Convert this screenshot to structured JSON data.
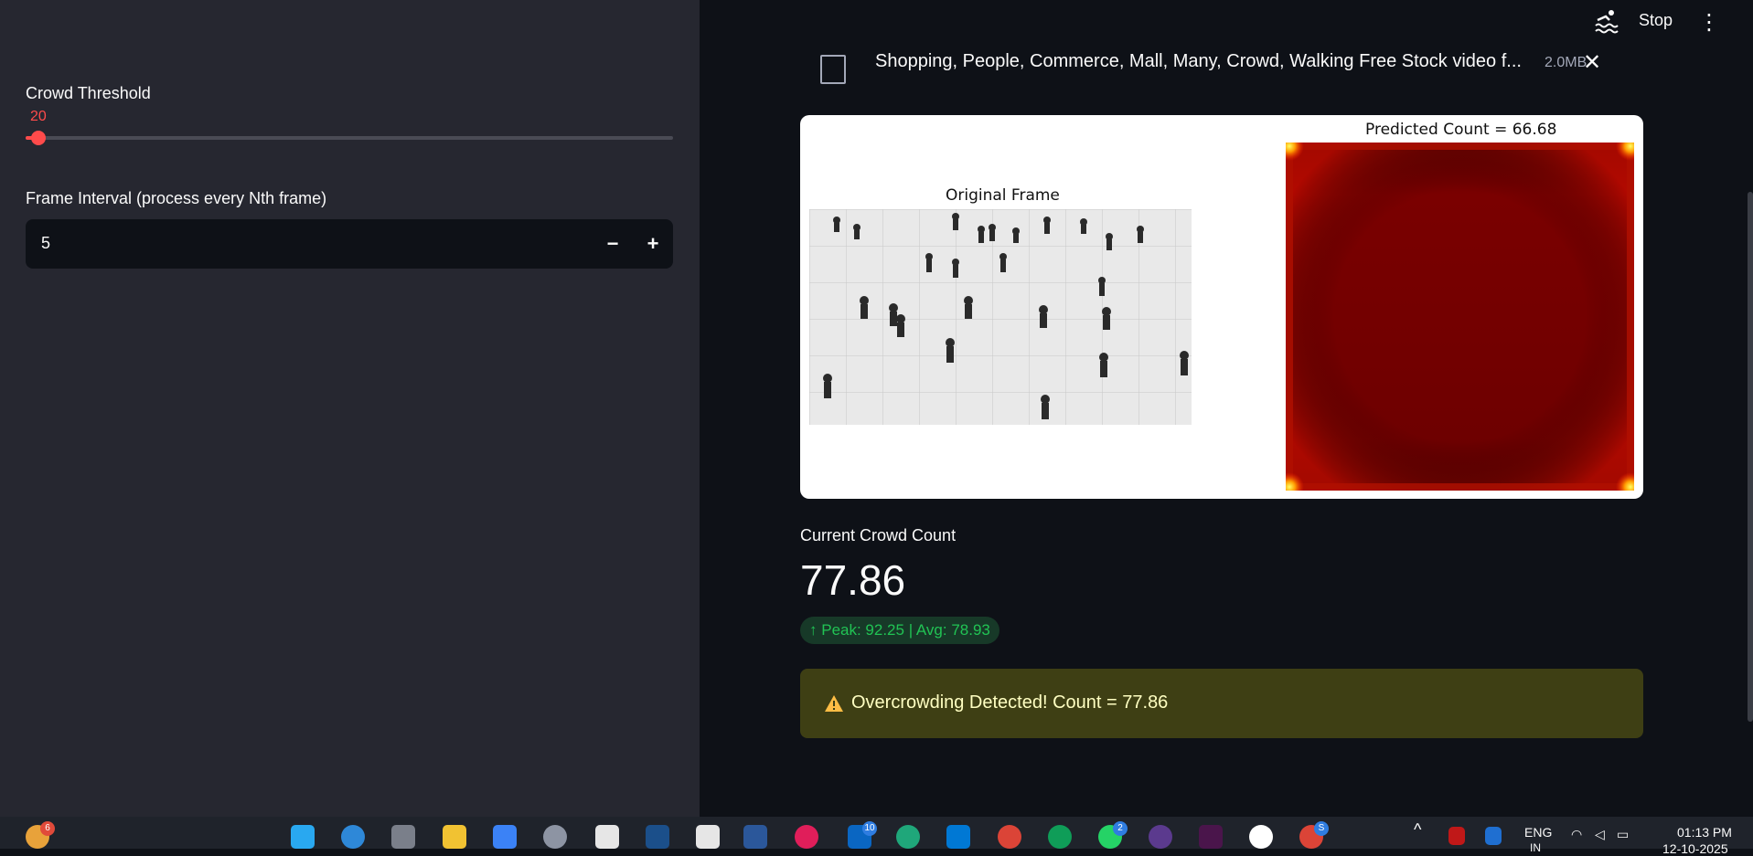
{
  "sidebar": {
    "threshold_label": "Crowd Threshold",
    "threshold_value": "20",
    "threshold_fraction": 0.02,
    "interval_label": "Frame Interval (process every Nth frame)",
    "interval_value": "5",
    "minus_label": "−",
    "plus_label": "+"
  },
  "header": {
    "stop_label": "Stop",
    "menu_label": "⋮"
  },
  "file": {
    "name": "Shopping, People, Commerce, Mall, Many, Crowd, Walking Free Stock video f...",
    "size": "2.0MB",
    "close_label": "✕"
  },
  "figure": {
    "left_title": "Original Frame",
    "right_title": "Predicted Count = 66.68"
  },
  "metric": {
    "label": "Current Crowd Count",
    "value": "77.86",
    "delta": "Peak: 92.25 | Avg: 78.93",
    "delta_arrow": "↑"
  },
  "alert": {
    "text": "Overcrowding Detected! Count = 77.86"
  },
  "taskbar": {
    "badge_1": "6",
    "badge_linkedin": "10",
    "badge_whatsapp": "2",
    "badge_chrome": "S",
    "lang": "ENG",
    "lang_sub": "IN",
    "time": "01:13 PM",
    "date": "12-10-2025"
  },
  "colors": {
    "accent": "#ff4b4b",
    "success": "#21c354",
    "warning_bg": "#3e3f14"
  }
}
